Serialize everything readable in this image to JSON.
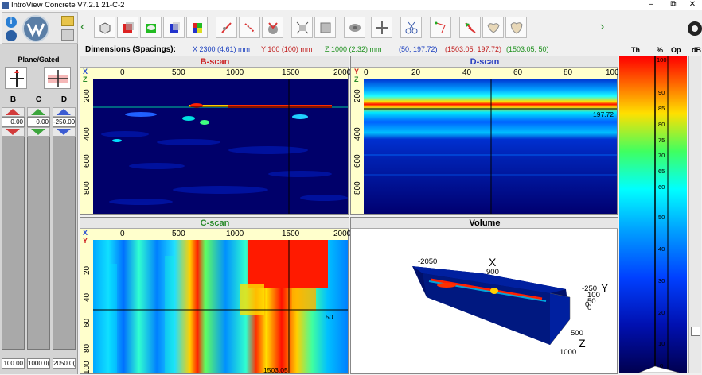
{
  "window": {
    "title": "IntroView Concrete V7.2.1   21-C-2",
    "controls": [
      "–",
      "⧉",
      "✕"
    ]
  },
  "left": {
    "plane_label": "Plane/Gated",
    "columns": [
      {
        "name": "B",
        "value": "0.00",
        "bottom": "100.00",
        "color": "#d23b3b"
      },
      {
        "name": "C",
        "value": "0.00",
        "bottom": "1000.0(",
        "color": "#3ca53c"
      },
      {
        "name": "D",
        "value": "-250.00",
        "bottom": "2050.0(",
        "color": "#3b5bd2"
      }
    ]
  },
  "dims": {
    "label": "Dimensions (Spacings):",
    "x": "X  2300 (4.61) mm",
    "y": "Y  100 (100) mm",
    "z": "Z  1000 (2.32) mm",
    "p1": "(50, 197.72)",
    "p2": "(1503.05, 197.72)",
    "p3": "(1503.05, 50)"
  },
  "bscan": {
    "title": "B-scan",
    "axis_x": "X",
    "axis_y": "Z",
    "xticks": [
      "0",
      "500",
      "1000",
      "1500",
      "2000"
    ],
    "yticks": [
      "200",
      "400",
      "600",
      "800"
    ]
  },
  "dscan": {
    "title": "D-scan",
    "axis_x": "Y",
    "axis_y": "Z",
    "xticks": [
      "0",
      "20",
      "40",
      "60",
      "80",
      "100"
    ],
    "yticks": [
      "200",
      "400",
      "600",
      "800"
    ],
    "marker": "197.72"
  },
  "cscan": {
    "title": "C-scan",
    "axis_x": "X",
    "axis_y": "Y",
    "xticks": [
      "0",
      "500",
      "1000",
      "1500",
      "2000"
    ],
    "yticks": [
      "20",
      "40",
      "60",
      "80",
      "100"
    ],
    "marker_a": "50",
    "marker_b": "1503.05"
  },
  "volume": {
    "title": "Volume",
    "x_label": "X",
    "y_label": "Y",
    "z_label": "Z",
    "x_900": "900",
    "x_2050": "-2050",
    "y_250": "-250",
    "y_100": "100",
    "y_50": "50",
    "y_0": "0",
    "z_500": "500",
    "z_1000": "1000",
    "side_0": "0"
  },
  "colorbar": {
    "th": "Th",
    "pct": "%",
    "op": "Op",
    "db": "dB",
    "labels": [
      "100",
      "90",
      "85",
      "80",
      "75",
      "70",
      "65",
      "60",
      "50",
      "40",
      "30",
      "20",
      "10",
      "0"
    ]
  }
}
